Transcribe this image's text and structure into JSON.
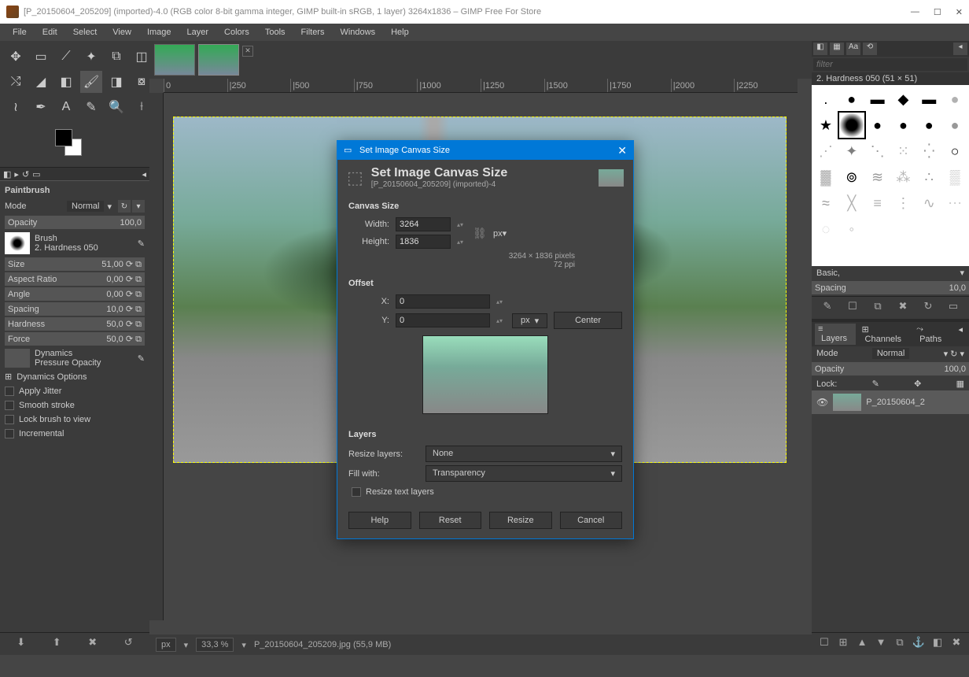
{
  "titlebar": {
    "text": "[P_20150604_205209] (imported)-4.0 (RGB color 8-bit gamma integer, GIMP built-in sRGB, 1 layer) 3264x1836 – GIMP Free For Store"
  },
  "menu": {
    "file": "File",
    "edit": "Edit",
    "select": "Select",
    "view": "View",
    "image": "Image",
    "layer": "Layer",
    "colors": "Colors",
    "tools": "Tools",
    "filters": "Filters",
    "windows": "Windows",
    "help": "Help"
  },
  "toolopts": {
    "title": "Paintbrush",
    "mode_label": "Mode",
    "mode_value": "Normal",
    "opacity_label": "Opacity",
    "opacity_value": "100,0",
    "brush_label": "Brush",
    "brush_name": "2. Hardness 050",
    "size_label": "Size",
    "size_value": "51,00",
    "aspect_label": "Aspect Ratio",
    "aspect_value": "0,00",
    "angle_label": "Angle",
    "angle_value": "0,00",
    "spacing_label": "Spacing",
    "spacing_value": "10,0",
    "hardness_label": "Hardness",
    "hardness_value": "50,0",
    "force_label": "Force",
    "force_value": "50,0",
    "dynamics_label": "Dynamics",
    "dynamics_value": "Pressure Opacity",
    "dyn_options": "Dynamics Options",
    "jitter": "Apply Jitter",
    "smooth": "Smooth stroke",
    "lock": "Lock brush to view",
    "incremental": "Incremental"
  },
  "ruler": {
    "r0": "0",
    "r1": "|250",
    "r2": "|500",
    "r3": "|750",
    "r4": "|1000",
    "r5": "|1250",
    "r6": "|1500",
    "r7": "|1750",
    "r8": "|2000",
    "r9": "|2250"
  },
  "status": {
    "unit": "px",
    "zoom": "33,3 %",
    "file": "P_20150604_205209.jpg (55,9 MB)"
  },
  "right": {
    "filter_placeholder": "filter",
    "brush_name": "2. Hardness 050 (51 × 51)",
    "basic": "Basic,",
    "spacing_label": "Spacing",
    "spacing_value": "10,0",
    "layers_tab": "Layers",
    "channels_tab": "Channels",
    "paths_tab": "Paths",
    "mode_label": "Mode",
    "mode_value": "Normal",
    "opacity_label": "Opacity",
    "opacity_value": "100,0",
    "lock_label": "Lock:",
    "layer_name": "P_20150604_2"
  },
  "dialog": {
    "title": "Set Image Canvas Size",
    "header": "Set Image Canvas Size",
    "subtitle": "[P_20150604_205209] (imported)-4",
    "canvas_size": "Canvas Size",
    "width_label": "Width:",
    "width_value": "3264",
    "height_label": "Height:",
    "height_value": "1836",
    "unit": "px",
    "info1": "3264 × 1836 pixels",
    "info2": "72 ppi",
    "offset": "Offset",
    "x_label": "X:",
    "x_value": "0",
    "y_label": "Y:",
    "y_value": "0",
    "center": "Center",
    "layers": "Layers",
    "resize_layers_label": "Resize layers:",
    "resize_layers_value": "None",
    "fill_label": "Fill with:",
    "fill_value": "Transparency",
    "resize_text": "Resize text layers",
    "help": "Help",
    "reset": "Reset",
    "resize": "Resize",
    "cancel": "Cancel"
  }
}
